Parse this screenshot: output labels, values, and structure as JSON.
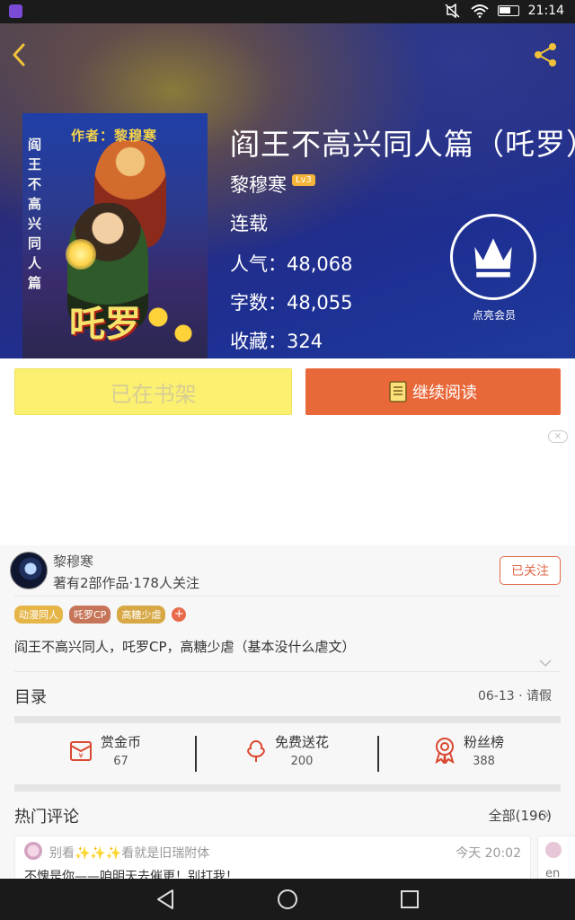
{
  "status_bar": {
    "time": "21:14"
  },
  "book": {
    "title": "阎王不高兴同人篇（吒罗）",
    "author": "黎穆寒",
    "author_level": "Lv3",
    "status": "连载",
    "popularity": "人气：48,068",
    "word_count": "字数：48,055",
    "favorites": "收藏：324",
    "cover": {
      "top_text": "作者：黎穆寒",
      "side_text": "阎王不高兴同人篇",
      "big_text": "吒罗"
    }
  },
  "vip": {
    "label": "点亮会员"
  },
  "actions": {
    "shelf_label": "已在书架",
    "read_label": "继续阅读"
  },
  "ad": {
    "close_label": "×"
  },
  "author_info": {
    "name": "黎穆寒",
    "meta": "著有2部作品·178人关注",
    "follow_label": "已关注",
    "tags": [
      "动漫同人",
      "吒罗CP",
      "高糖少虐"
    ],
    "add_tag": "+",
    "description": "阎王不高兴同人，吒罗CP，高糖少虐（基本没什么虐文）"
  },
  "catalog": {
    "title": "目录",
    "latest": "06-13 · 请假"
  },
  "rewards": [
    {
      "label": "赏金币",
      "count": "67",
      "icon": "coin-envelope-icon"
    },
    {
      "label": "免费送花",
      "count": "200",
      "icon": "flower-icon"
    },
    {
      "label": "粉丝榜",
      "count": "388",
      "icon": "medal-icon"
    }
  ],
  "comments": {
    "title": "热门评论",
    "all_label": "全部(196)",
    "items": [
      {
        "user": "别看✨✨✨看就是旧瑞附体",
        "time": "今天 20:02",
        "text": "不愧是你——咱明天去催更！别打我！"
      }
    ],
    "peek_text": "en"
  },
  "colors": {
    "accent_orange": "#e9683a",
    "shelf_yellow": "#fbf070",
    "tag_red": "#e86a4a"
  }
}
